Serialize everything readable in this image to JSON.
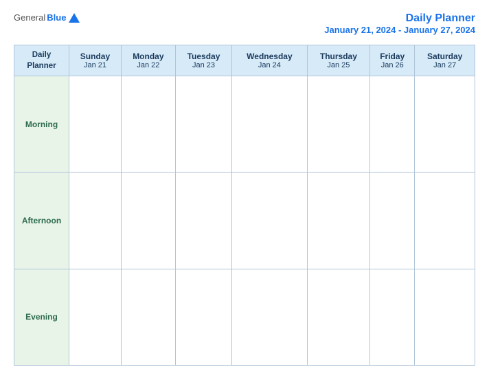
{
  "header": {
    "logo": {
      "general": "General",
      "blue": "Blue",
      "triangle": true
    },
    "title": "Daily Planner",
    "date_range": "January 21, 2024 - January 27, 2024"
  },
  "columns": [
    {
      "id": "planner",
      "name": "Daily\nPlanner",
      "date": ""
    },
    {
      "id": "sunday",
      "name": "Sunday",
      "date": "Jan 21"
    },
    {
      "id": "monday",
      "name": "Monday",
      "date": "Jan 22"
    },
    {
      "id": "tuesday",
      "name": "Tuesday",
      "date": "Jan 23"
    },
    {
      "id": "wednesday",
      "name": "Wednesday",
      "date": "Jan 24"
    },
    {
      "id": "thursday",
      "name": "Thursday",
      "date": "Jan 25"
    },
    {
      "id": "friday",
      "name": "Friday",
      "date": "Jan 26"
    },
    {
      "id": "saturday",
      "name": "Saturday",
      "date": "Jan 27"
    }
  ],
  "rows": [
    {
      "id": "morning",
      "label": "Morning"
    },
    {
      "id": "afternoon",
      "label": "Afternoon"
    },
    {
      "id": "evening",
      "label": "Evening"
    }
  ]
}
